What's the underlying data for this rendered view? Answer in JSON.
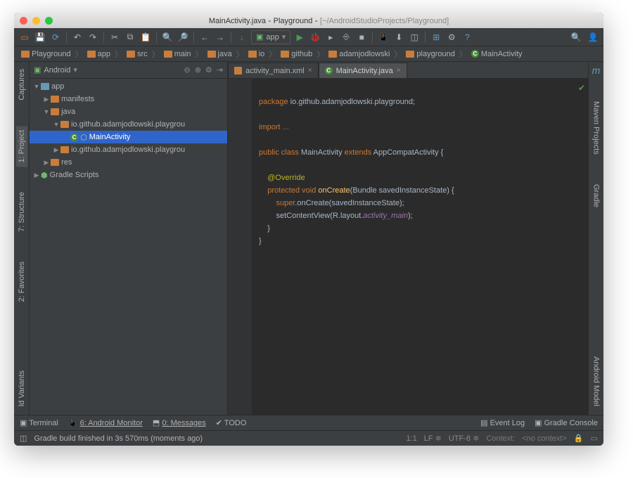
{
  "title": {
    "file": "MainActivity.java",
    "project": "Playground",
    "path": "[~/AndroidStudioProjects/Playground]"
  },
  "run_config": "app",
  "breadcrumbs": [
    "Playground",
    "app",
    "src",
    "main",
    "java",
    "io",
    "github",
    "adamjodlowski",
    "playground"
  ],
  "breadcrumb_last": "MainActivity",
  "project_panel": {
    "title": "Android"
  },
  "tree": {
    "app": "app",
    "manifests": "manifests",
    "java": "java",
    "pkg1": "io.github.adamjodlowski.playgrou",
    "main": "MainActivity",
    "pkg2": "io.github.adamjodlowski.playgrou",
    "res": "res",
    "gradle": "Gradle Scripts"
  },
  "tabs": [
    {
      "label": "activity_main.xml"
    },
    {
      "label": "MainActivity.java"
    }
  ],
  "code": {
    "l1_a": "package",
    "l1_b": "io.github.adamjodlowski.playground;",
    "l3_a": "import",
    "l3_b": "...",
    "l5_a": "public class",
    "l5_b": "MainActivity",
    "l5_c": "extends",
    "l5_d": "AppCompatActivity {",
    "l7": "@Override",
    "l8_a": "protected void",
    "l8_b": "onCreate",
    "l8_c": "(Bundle savedInstanceState) {",
    "l9_a": "super",
    "l9_b": ".onCreate(savedInstanceState);",
    "l10_a": "setContentView(R.layout.",
    "l10_b": "activity_main",
    "l10_c": ");",
    "l11": "    }",
    "l12": "}"
  },
  "left_tabs": {
    "captures": "Captures",
    "project": "1: Project",
    "structure": "7: Structure",
    "favorites": "2: Favorites",
    "variants": "ld Variants"
  },
  "right_tabs": {
    "maven": "Maven Projects",
    "gradle": "Gradle",
    "model": "Android Model",
    "m": "m"
  },
  "bottom": {
    "terminal": "Terminal",
    "monitor": "6: Android Monitor",
    "messages": "0: Messages",
    "todo": "TODO",
    "eventlog": "Event Log",
    "console": "Gradle Console"
  },
  "status": {
    "msg": "Gradle build finished in 3s 570ms (moments ago)",
    "pos": "1:1",
    "le": "LF",
    "enc": "UTF-8",
    "ctx": "Context:",
    "ctxv": "<no context>"
  }
}
